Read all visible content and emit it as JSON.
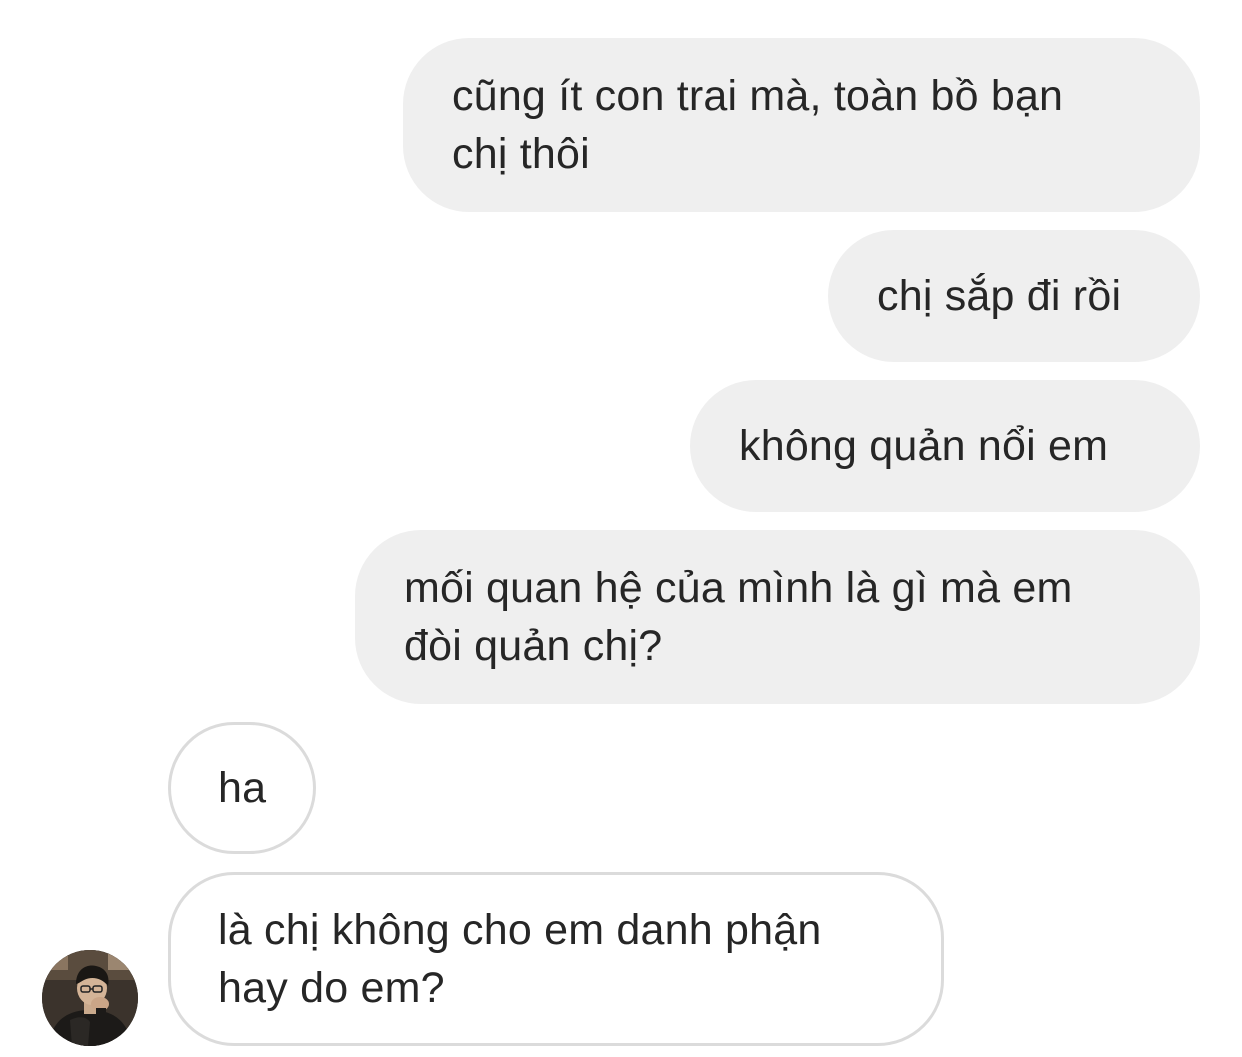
{
  "conversation": {
    "messages": [
      {
        "sender": "me",
        "text": "cũng ít con trai mà, toàn bồ bạn\nchị thôi"
      },
      {
        "sender": "me",
        "text": "chị sắp đi rồi"
      },
      {
        "sender": "me",
        "text": "không quản nổi em"
      },
      {
        "sender": "me",
        "text": "mối quan hệ của mình là gì mà em\nđòi quản chị?"
      },
      {
        "sender": "other",
        "text": "ha"
      },
      {
        "sender": "other",
        "text": "là chị không cho em danh phận\nhay do em?"
      }
    ],
    "other_avatar": {
      "icon": "user-avatar-photo"
    }
  },
  "colors": {
    "sent_bubble": "#efefef",
    "received_border": "#dbdbdb",
    "text": "#262626",
    "background": "#ffffff"
  }
}
